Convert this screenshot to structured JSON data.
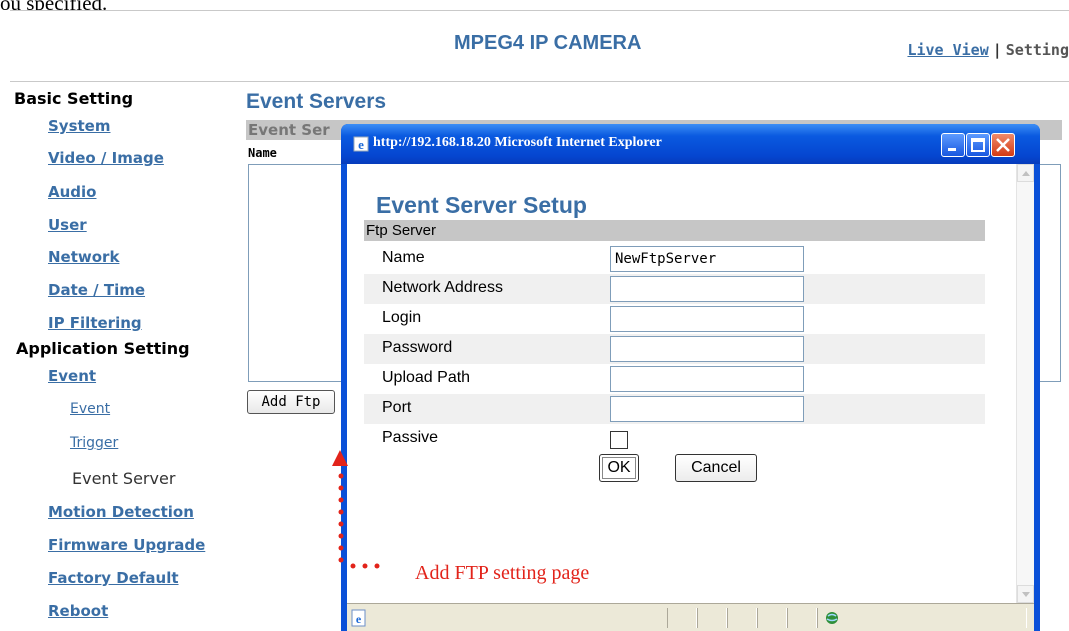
{
  "clipped_text": "ou specified.",
  "header": {
    "brand": "MPEG4 IP CAMERA",
    "live_view": "Live View",
    "separator": "|",
    "setting": "Setting"
  },
  "sidebar": {
    "basic_heading": "Basic Setting",
    "basic_items": [
      "System",
      "Video / Image",
      "Audio",
      "User",
      "Network",
      "Date / Time",
      "IP Filtering"
    ],
    "app_heading": "Application Setting",
    "event": "Event",
    "event_subitems": [
      "Event",
      "Trigger"
    ],
    "current_item": "Event Server",
    "app_items": [
      "Motion Detection",
      "Firmware Upgrade",
      "Factory Default",
      "Reboot"
    ]
  },
  "main": {
    "title": "Event Servers",
    "subheader": "Event Ser",
    "column_name": "Name",
    "add_ftp_button": "Add Ftp"
  },
  "popup": {
    "window_title": "http://192.168.18.20  Microsoft Internet Explorer",
    "heading": "Event Server Setup",
    "section": "Ftp Server",
    "fields": [
      {
        "label": "Name",
        "value": "NewFtpServer"
      },
      {
        "label": "Network Address",
        "value": ""
      },
      {
        "label": "Login",
        "value": ""
      },
      {
        "label": "Password",
        "value": ""
      },
      {
        "label": "Upload Path",
        "value": ""
      },
      {
        "label": "Port",
        "value": ""
      }
    ],
    "passive_label": "Passive",
    "passive_checked": false,
    "ok_button": "OK",
    "cancel_button": "Cancel"
  },
  "annotation": {
    "text": "Add FTP setting page",
    "color": "#e2231a"
  },
  "colors": {
    "accent": "#3a6ea5",
    "titlebar": "#0a50d8"
  },
  "icons": [
    "ie-icon",
    "minimize-icon",
    "maximize-icon",
    "close-icon",
    "page-icon",
    "internet-zone-icon"
  ]
}
